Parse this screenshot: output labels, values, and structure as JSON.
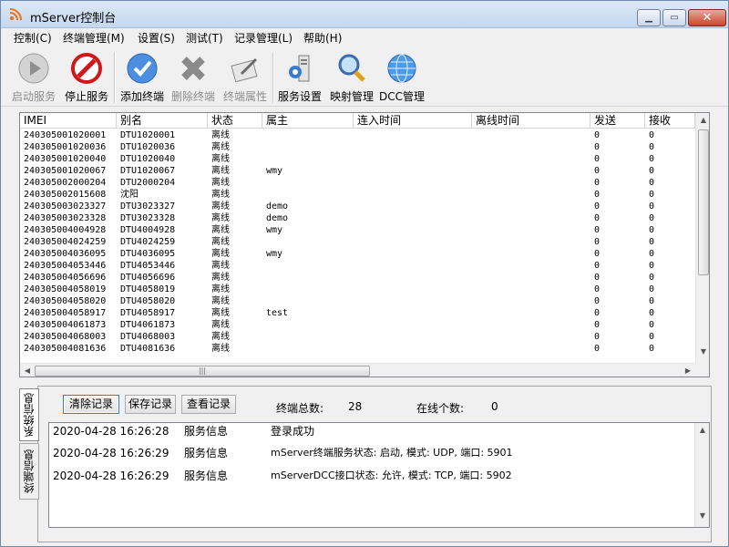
{
  "window": {
    "title": "mServer控制台",
    "icon": "rss-feed-icon"
  },
  "menu": [
    "控制(C)",
    "终端管理(M)",
    "设置(S)",
    "测试(T)",
    "记录管理(L)",
    "帮助(H)"
  ],
  "toolbar": [
    {
      "label": "启动服务",
      "icon": "play-icon",
      "disabled": true
    },
    {
      "label": "停止服务",
      "icon": "stop-icon",
      "disabled": false
    },
    {
      "label": "添加终端",
      "icon": "checkmark-icon",
      "disabled": false
    },
    {
      "label": "删除终端",
      "icon": "delete-x-icon",
      "disabled": true
    },
    {
      "label": "终端属性",
      "icon": "properties-pen-icon",
      "disabled": true
    },
    {
      "label": "服务设置",
      "icon": "server-settings-icon",
      "disabled": false
    },
    {
      "label": "映射管理",
      "icon": "magnifier-icon",
      "disabled": false
    },
    {
      "label": "DCC管理",
      "icon": "globe-icon",
      "disabled": false
    }
  ],
  "grid": {
    "columns": [
      "IMEI",
      "别名",
      "状态",
      "属主",
      "连入时间",
      "离线时间",
      "发送",
      "接收"
    ],
    "rows": [
      [
        "240305001020001",
        "DTU1020001",
        "离线",
        "",
        "",
        "",
        "0",
        "0"
      ],
      [
        "240305001020036",
        "DTU1020036",
        "离线",
        "",
        "",
        "",
        "0",
        "0"
      ],
      [
        "240305001020040",
        "DTU1020040",
        "离线",
        "",
        "",
        "",
        "0",
        "0"
      ],
      [
        "240305001020067",
        "DTU1020067",
        "离线",
        "wmy",
        "",
        "",
        "0",
        "0"
      ],
      [
        "240305002000204",
        "DTU2000204",
        "离线",
        "",
        "",
        "",
        "0",
        "0"
      ],
      [
        "240305002015608",
        "沈阳",
        "离线",
        "",
        "",
        "",
        "0",
        "0"
      ],
      [
        "240305003023327",
        "DTU3023327",
        "离线",
        "demo",
        "",
        "",
        "0",
        "0"
      ],
      [
        "240305003023328",
        "DTU3023328",
        "离线",
        "demo",
        "",
        "",
        "0",
        "0"
      ],
      [
        "240305004004928",
        "DTU4004928",
        "离线",
        "wmy",
        "",
        "",
        "0",
        "0"
      ],
      [
        "240305004024259",
        "DTU4024259",
        "离线",
        "",
        "",
        "",
        "0",
        "0"
      ],
      [
        "240305004036095",
        "DTU4036095",
        "离线",
        "wmy",
        "",
        "",
        "0",
        "0"
      ],
      [
        "240305004053446",
        "DTU4053446",
        "离线",
        "",
        "",
        "",
        "0",
        "0"
      ],
      [
        "240305004056696",
        "DTU4056696",
        "离线",
        "",
        "",
        "",
        "0",
        "0"
      ],
      [
        "240305004058019",
        "DTU4058019",
        "离线",
        "",
        "",
        "",
        "0",
        "0"
      ],
      [
        "240305004058020",
        "DTU4058020",
        "离线",
        "",
        "",
        "",
        "0",
        "0"
      ],
      [
        "240305004058917",
        "DTU4058917",
        "离线",
        "test",
        "",
        "",
        "0",
        "0"
      ],
      [
        "240305004061873",
        "DTU4061873",
        "离线",
        "",
        "",
        "",
        "0",
        "0"
      ],
      [
        "240305004068003",
        "DTU4068003",
        "离线",
        "",
        "",
        "",
        "0",
        "0"
      ],
      [
        "240305004081636",
        "DTU4081636",
        "离线",
        "",
        "",
        "",
        "0",
        "0"
      ]
    ]
  },
  "side_tabs": [
    "系统信息",
    "终端信息"
  ],
  "log_buttons": [
    "清除记录",
    "保存记录",
    "查看记录"
  ],
  "stats": {
    "total_label": "终端总数:",
    "total_value": "28",
    "online_label": "在线个数:",
    "online_value": "0"
  },
  "log": [
    {
      "time": "2020-04-28 16:26:28",
      "type": "服务信息",
      "message": "登录成功"
    },
    {
      "time": "2020-04-28 16:26:29",
      "type": "服务信息",
      "message": "mServer终端服务状态: 启动, 模式: UDP, 端口: 5901"
    },
    {
      "time": "2020-04-28 16:26:29",
      "type": "服务信息",
      "message": "mServerDCC接口状态: 允许, 模式: TCP, 端口: 5902"
    }
  ]
}
